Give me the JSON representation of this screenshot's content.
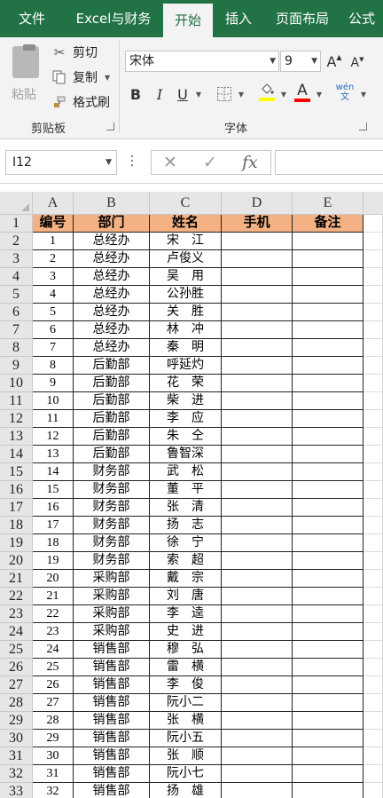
{
  "ribbon_tabs": [
    "文件",
    "Excel与财务",
    "开始",
    "插入",
    "页面布局",
    "公式"
  ],
  "active_tab": "开始",
  "clipboard": {
    "paste_label": "粘贴",
    "cut_label": "剪切",
    "copy_label": "复制",
    "format_painter_label": "格式刷",
    "group_label": "剪贴板"
  },
  "font": {
    "name": "宋体",
    "size": "9",
    "group_label": "字体",
    "grow_label": "A",
    "shrink_label": "A",
    "bold": "B",
    "italic": "I",
    "underline": "U",
    "font_color_label": "A",
    "phonetic_label": "wén 文"
  },
  "formula_bar": {
    "name_box": "I12",
    "cancel_symbol": "✕",
    "enter_symbol": "✓",
    "fx_label": "fx",
    "formula": ""
  },
  "colors": {
    "ribbon_green": "#217346",
    "header_fill": "#f4b183",
    "fill_highlight": "#ffff00",
    "font_color_red": "#ff0000"
  },
  "sheet": {
    "column_letters": [
      "A",
      "B",
      "C",
      "D",
      "E"
    ],
    "header_row_number": "1",
    "headers": [
      "编号",
      "部门",
      "姓名",
      "手机",
      "备注"
    ],
    "rows": [
      {
        "row": "2",
        "id": "1",
        "dept": "总经办",
        "name": "宋　江"
      },
      {
        "row": "3",
        "id": "2",
        "dept": "总经办",
        "name": "卢俊义"
      },
      {
        "row": "4",
        "id": "3",
        "dept": "总经办",
        "name": "吴　用"
      },
      {
        "row": "5",
        "id": "4",
        "dept": "总经办",
        "name": "公孙胜"
      },
      {
        "row": "6",
        "id": "5",
        "dept": "总经办",
        "name": "关　胜"
      },
      {
        "row": "7",
        "id": "6",
        "dept": "总经办",
        "name": "林　冲"
      },
      {
        "row": "8",
        "id": "7",
        "dept": "总经办",
        "name": "秦　明"
      },
      {
        "row": "9",
        "id": "8",
        "dept": "后勤部",
        "name": "呼延灼"
      },
      {
        "row": "10",
        "id": "9",
        "dept": "后勤部",
        "name": "花　荣"
      },
      {
        "row": "11",
        "id": "10",
        "dept": "后勤部",
        "name": "柴　进"
      },
      {
        "row": "12",
        "id": "11",
        "dept": "后勤部",
        "name": "李　应"
      },
      {
        "row": "13",
        "id": "12",
        "dept": "后勤部",
        "name": "朱　仝"
      },
      {
        "row": "14",
        "id": "13",
        "dept": "后勤部",
        "name": "鲁智深"
      },
      {
        "row": "15",
        "id": "14",
        "dept": "财务部",
        "name": "武　松"
      },
      {
        "row": "16",
        "id": "15",
        "dept": "财务部",
        "name": "董　平"
      },
      {
        "row": "17",
        "id": "16",
        "dept": "财务部",
        "name": "张　清"
      },
      {
        "row": "18",
        "id": "17",
        "dept": "财务部",
        "name": "扬　志"
      },
      {
        "row": "19",
        "id": "18",
        "dept": "财务部",
        "name": "徐　宁"
      },
      {
        "row": "20",
        "id": "19",
        "dept": "财务部",
        "name": "索　超"
      },
      {
        "row": "21",
        "id": "20",
        "dept": "采购部",
        "name": "戴　宗"
      },
      {
        "row": "22",
        "id": "21",
        "dept": "采购部",
        "name": "刘　唐"
      },
      {
        "row": "23",
        "id": "22",
        "dept": "采购部",
        "name": "李　逵"
      },
      {
        "row": "24",
        "id": "23",
        "dept": "采购部",
        "name": "史　进"
      },
      {
        "row": "25",
        "id": "24",
        "dept": "销售部",
        "name": "穆　弘"
      },
      {
        "row": "26",
        "id": "25",
        "dept": "销售部",
        "name": "雷　横"
      },
      {
        "row": "27",
        "id": "26",
        "dept": "销售部",
        "name": "李　俊"
      },
      {
        "row": "28",
        "id": "27",
        "dept": "销售部",
        "name": "阮小二"
      },
      {
        "row": "29",
        "id": "28",
        "dept": "销售部",
        "name": "张　横"
      },
      {
        "row": "30",
        "id": "29",
        "dept": "销售部",
        "name": "阮小五"
      },
      {
        "row": "31",
        "id": "30",
        "dept": "销售部",
        "name": "张　顺"
      },
      {
        "row": "32",
        "id": "31",
        "dept": "销售部",
        "name": "阮小七"
      },
      {
        "row": "33",
        "id": "32",
        "dept": "销售部",
        "name": "扬　雄"
      }
    ]
  }
}
